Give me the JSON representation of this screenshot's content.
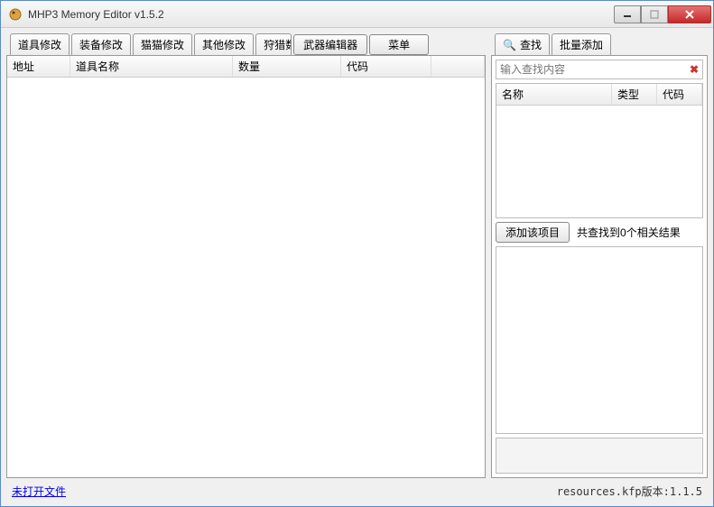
{
  "window": {
    "title": "MHP3 Memory Editor v1.5.2"
  },
  "left": {
    "tabs": [
      {
        "label": "道具修改"
      },
      {
        "label": "装备修改"
      },
      {
        "label": "猫猫修改"
      },
      {
        "label": "其他修改"
      },
      {
        "label": "狩猎数"
      },
      {
        "label": "武器编辑器"
      }
    ],
    "menu_button": "菜单",
    "columns": {
      "addr": "地址",
      "name": "道具名称",
      "qty": "数量",
      "code": "代码"
    }
  },
  "right": {
    "tabs": [
      {
        "label": "查找",
        "icon": "🔍"
      },
      {
        "label": "批量添加"
      }
    ],
    "search_placeholder": "输入查找内容",
    "result_columns": {
      "name": "名称",
      "type": "类型",
      "code": "代码"
    },
    "add_button": "添加该项目",
    "result_summary": "共查找到0个相关结果"
  },
  "status": {
    "left": "未打开文件",
    "right": "resources.kfp版本:1.1.5"
  }
}
